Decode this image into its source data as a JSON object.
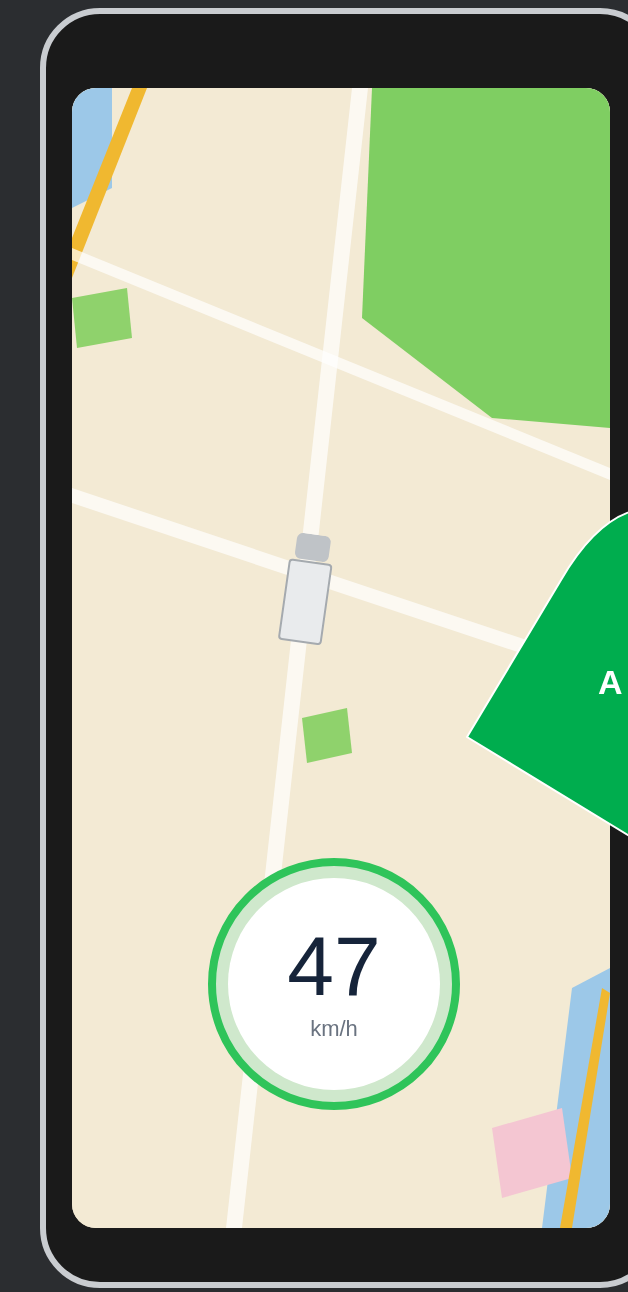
{
  "speedometer": {
    "speed": "47",
    "unit": "km/h"
  },
  "callout": {
    "text": "A"
  }
}
